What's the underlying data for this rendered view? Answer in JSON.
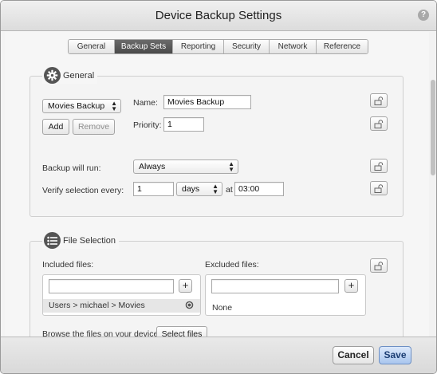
{
  "window": {
    "title": "Device Backup Settings"
  },
  "tabs": [
    {
      "label": "General"
    },
    {
      "label": "Backup Sets"
    },
    {
      "label": "Reporting"
    },
    {
      "label": "Security"
    },
    {
      "label": "Network"
    },
    {
      "label": "Reference"
    }
  ],
  "general": {
    "heading": "General",
    "backup_set_select": "Movies Backup",
    "add_label": "Add",
    "remove_label": "Remove",
    "name_label": "Name:",
    "name_value": "Movies Backup",
    "priority_label": "Priority:",
    "priority_value": "1",
    "backup_run_label": "Backup will run:",
    "backup_run_value": "Always",
    "verify_label": "Verify selection every:",
    "verify_count": "1",
    "verify_unit": "days",
    "at_label": "at",
    "verify_time": "03:00"
  },
  "file_selection": {
    "heading": "File Selection",
    "included_label": "Included files:",
    "excluded_label": "Excluded files:",
    "included_paths": [
      "Users > michael > Movies"
    ],
    "excluded_value": "None",
    "plus_label": "+",
    "browse_label": "Browse the files on your device:",
    "select_files_label": "Select files"
  },
  "footer": {
    "cancel_label": "Cancel",
    "save_label": "Save"
  },
  "colors": {
    "accent": "#a9c6ee",
    "active_tab": "#555555"
  }
}
